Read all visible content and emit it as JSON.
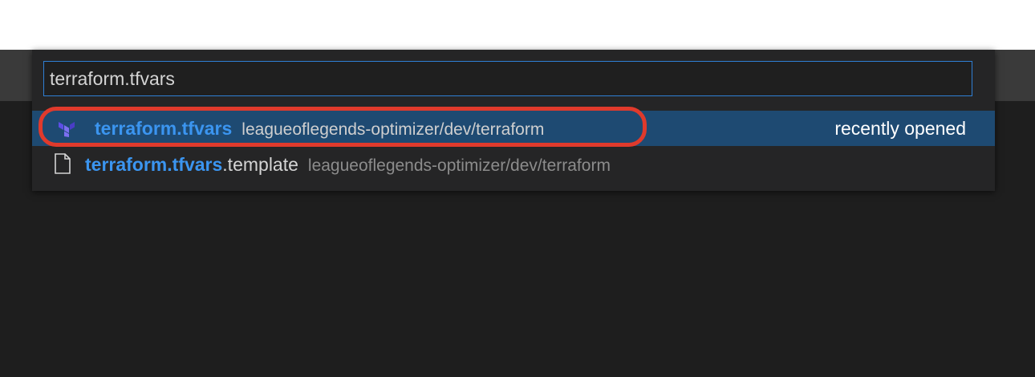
{
  "colors": {
    "accent": "#2f7fd4",
    "match_highlight": "#3b95f0",
    "selected_row": "#1e4a72",
    "annotation": "#e03a2c"
  },
  "quick_open": {
    "search_value": "terraform.tfvars",
    "results": [
      {
        "icon": "terraform-icon",
        "name_match": "terraform.tfvars",
        "name_rest": "",
        "path": "leagueoflegends-optimizer/dev/terraform",
        "badge": "recently opened",
        "selected": true
      },
      {
        "icon": "file-icon",
        "name_match": "terraform.tfvars",
        "name_rest": ".template",
        "path": "leagueoflegends-optimizer/dev/terraform",
        "badge": "",
        "selected": false
      }
    ]
  }
}
